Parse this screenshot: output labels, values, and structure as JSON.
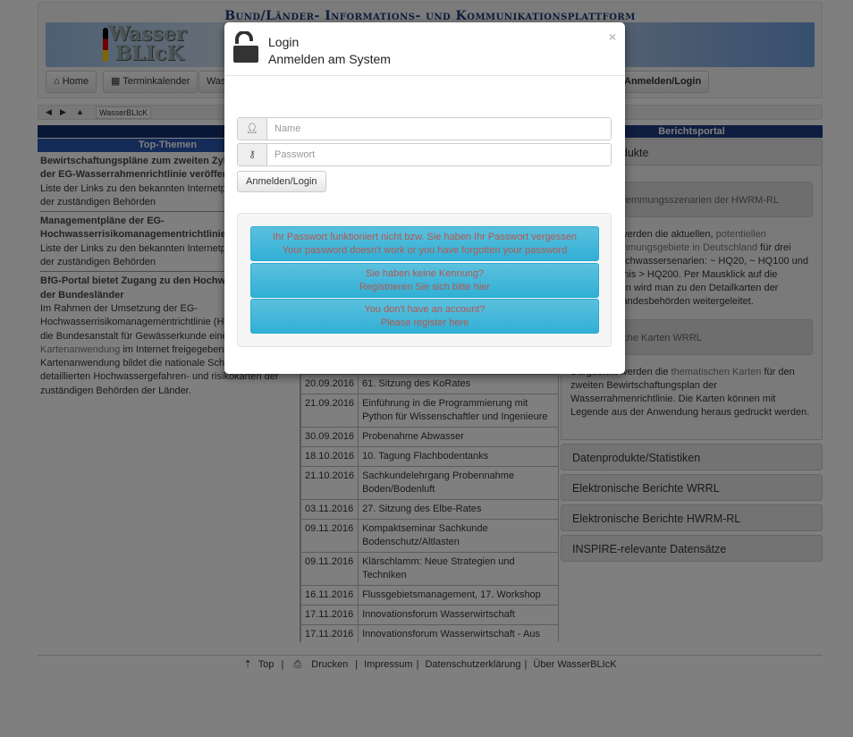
{
  "site_title": "Bund/Länder- Informations- und Kommunikationsplattform",
  "logo": "WasserBLIcK",
  "nav": {
    "home": "Home",
    "calendar": "Terminkalender",
    "wasser": "Was",
    "login": "Anmelden/Login"
  },
  "breadcrumb": {
    "current": "WasserBLIcK"
  },
  "left": {
    "heading": "Top-Themen",
    "items": [
      {
        "title": "Bewirtschaftungspläne zum zweiten Zyklus 2016-2021 der EG-Wasserrahmenrichtlinie veröffentlicht",
        "text": "Liste der Links zu den bekannten Internetpräsentationen der zuständigen Behörden"
      },
      {
        "title": "Managementpläne der EG-Hochwasserrisikomanagementrichtlinie veröffentlicht",
        "text": "Liste der Links zu den bekannten Internetpräsentationen der zuständigen Behörden"
      },
      {
        "title": "BfG-Portal bietet Zugang zu den Hochwasserkarten der Bundesländer",
        "text_1": "Im Rahmen der Umsetzung der EG-Hochwasserrisikomanagementrichtlinie (HWRM-RL) hat die Bundesanstalt für Gewässerkunde eine ",
        "link": "Kartenanwendung",
        "text_2": " im Internet freigegeben. Die Kartenanwendung bildet die nationale Schnittstelle zu den detaillierten Hochwassergefahren- und risikokarten der zuständigen Behörden der Länder."
      }
    ]
  },
  "events": [
    {
      "date": "20.09.2016",
      "title": "61. Sitzung des KoRates"
    },
    {
      "date": "21.09.2016",
      "title": "Einführung in die Programmierung mit Python für Wissenschaftler und Ingenieure"
    },
    {
      "date": "30.09.2016",
      "title": "Probenahme Abwasser"
    },
    {
      "date": "18.10.2016",
      "title": "10. Tagung Flachbodentanks"
    },
    {
      "date": "21.10.2016",
      "title": "Sachkundelehrgang Probennahme Boden/Bodenluft"
    },
    {
      "date": "03.11.2016",
      "title": "27. Sitzung des Elbe-Rates"
    },
    {
      "date": "09.11.2016",
      "title": "Kompaktseminar Sachkunde Bodenschutz/Altlasten"
    },
    {
      "date": "09.11.2016",
      "title": "Klärschlamm: Neue Strategien und Techniken"
    },
    {
      "date": "16.11.2016",
      "title": "Flussgebietsmanagement, 17. Workshop"
    },
    {
      "date": "17.11.2016",
      "title": "Innovationsforum Wasserwirtschaft"
    },
    {
      "date": "17.11.2016",
      "title": "Innovationsforum Wasserwirtschaft - Aus der Forschung in die Praxis"
    }
  ],
  "right": {
    "heading": "Berichtsportal",
    "open_section": "Kartenprodukte",
    "sub1": "Überschwemmungsszenarien der HWRM-RL",
    "p1_a": "Dargestellt werden die aktuellen, ",
    "p1_link": "potentiellen Überschwemmungsgebiete in Deutschland",
    "p1_b": " für drei mögliche Hochwassersenarien: ~ HQ20, ~ HQ100 und Extremereignis > HQ200. Per Mausklick auf die Kartenflächen wird man zu den Detailkarten der jeweiligen Landesbehörden weitergeleitet.",
    "sub2": "Thematische Karten WRRL",
    "p2_a": "Dargestellt werden die ",
    "p2_link": "thematischen Karten",
    "p2_b": " für den zweiten Bewirtschaftungsplan der Wasserrahmenrichtlinie. Die Karten können mit Legende aus der Anwendung heraus gedruckt werden.",
    "sections": [
      "Datenprodukte/Statistiken",
      "Elektronische Berichte WRRL",
      "Elektronische Berichte HWRM-RL",
      "INSPIRE-relevante Datensätze"
    ]
  },
  "footer": {
    "top": "Top",
    "print": "Drucken",
    "imprint": "Impressum",
    "privacy": "Datenschutzerklärung",
    "about": "Über WasserBLIcK"
  },
  "modal": {
    "title": "Login",
    "subtitle": "Anmelden am System",
    "close": "×",
    "name_placeholder": "Name",
    "password_placeholder": "Passwort",
    "login_button": "Anmelden/Login",
    "forgot_de": "Ihr Passwort funktioniert nicht bzw. Sie haben Ihr Passwort vergessen",
    "forgot_en": "Your password doesn't work or you have forgotten your password",
    "register_de_1": "Sie haben keine Kennung?",
    "register_de_2": "Registrieren Sie sich bitte hier",
    "register_en_1": "You don't have an account?",
    "register_en_2": "Please register here"
  }
}
